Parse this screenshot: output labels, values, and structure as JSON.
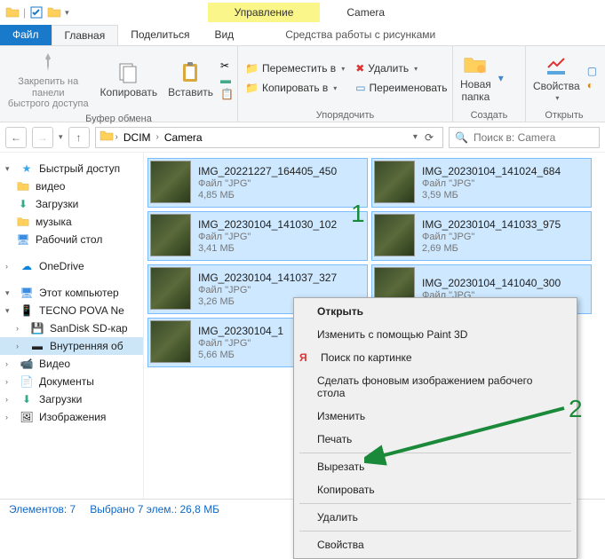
{
  "title": {
    "manage": "Управление",
    "toolsTab": "Средства работы с рисунками",
    "window": "Camera"
  },
  "tabs": {
    "file": "Файл",
    "home": "Главная",
    "share": "Поделиться",
    "view": "Вид"
  },
  "ribbon": {
    "pin": "Закрепить на панели\nбыстрого доступа",
    "copy": "Копировать",
    "paste": "Вставить",
    "clipboardGroup": "Буфер обмена",
    "moveTo": "Переместить в",
    "copyTo": "Копировать в",
    "delete": "Удалить",
    "rename": "Переименовать",
    "organizeGroup": "Упорядочить",
    "newFolder": "Новая\nпапка",
    "newGroup": "Создать",
    "properties": "Свойства",
    "openGroup": "Открыть"
  },
  "breadcrumb": {
    "seg1": "DCIM",
    "seg2": "Camera"
  },
  "search": {
    "placeholder": "Поиск в: Camera"
  },
  "sidebar": {
    "quickAccess": "Быстрый доступ",
    "video": "видео",
    "downloads": "Загрузки",
    "music": "музыка",
    "desktop": "Рабочий стол",
    "onedrive": "OneDrive",
    "thisPc": "Этот компьютер",
    "tecno": "TECNO POVA Ne",
    "sandisk": "SanDisk SD-кар",
    "internal": "Внутренняя об",
    "videos2": "Видео",
    "documents": "Документы",
    "downloads2": "Загрузки",
    "images": "Изображения"
  },
  "files": [
    {
      "name": "IMG_20221227_164405_450",
      "type": "Файл \"JPG\"",
      "size": "4,85 МБ"
    },
    {
      "name": "IMG_20230104_141024_684",
      "type": "Файл \"JPG\"",
      "size": "3,59 МБ"
    },
    {
      "name": "IMG_20230104_141030_102",
      "type": "Файл \"JPG\"",
      "size": "3,41 МБ"
    },
    {
      "name": "IMG_20230104_141033_975",
      "type": "Файл \"JPG\"",
      "size": "2,69 МБ"
    },
    {
      "name": "IMG_20230104_141037_327",
      "type": "Файл \"JPG\"",
      "size": "3,26 МБ"
    },
    {
      "name": "IMG_20230104_141040_300",
      "type": "Файл \"JPG\"",
      "size": ""
    },
    {
      "name": "IMG_20230104_1",
      "type": "Файл \"JPG\"",
      "size": "5,66 МБ"
    }
  ],
  "context": {
    "open": "Открыть",
    "paint3d": "Изменить с помощью Paint 3D",
    "yandex": "Поиск по картинке",
    "wallpaper": "Сделать фоновым изображением рабочего стола",
    "edit": "Изменить",
    "print": "Печать",
    "cut": "Вырезать",
    "copy": "Копировать",
    "delete": "Удалить",
    "properties": "Свойства"
  },
  "status": {
    "count": "Элементов: 7",
    "selected": "Выбрано 7 элем.: 26,8 МБ"
  },
  "annotations": {
    "one": "1",
    "two": "2"
  }
}
